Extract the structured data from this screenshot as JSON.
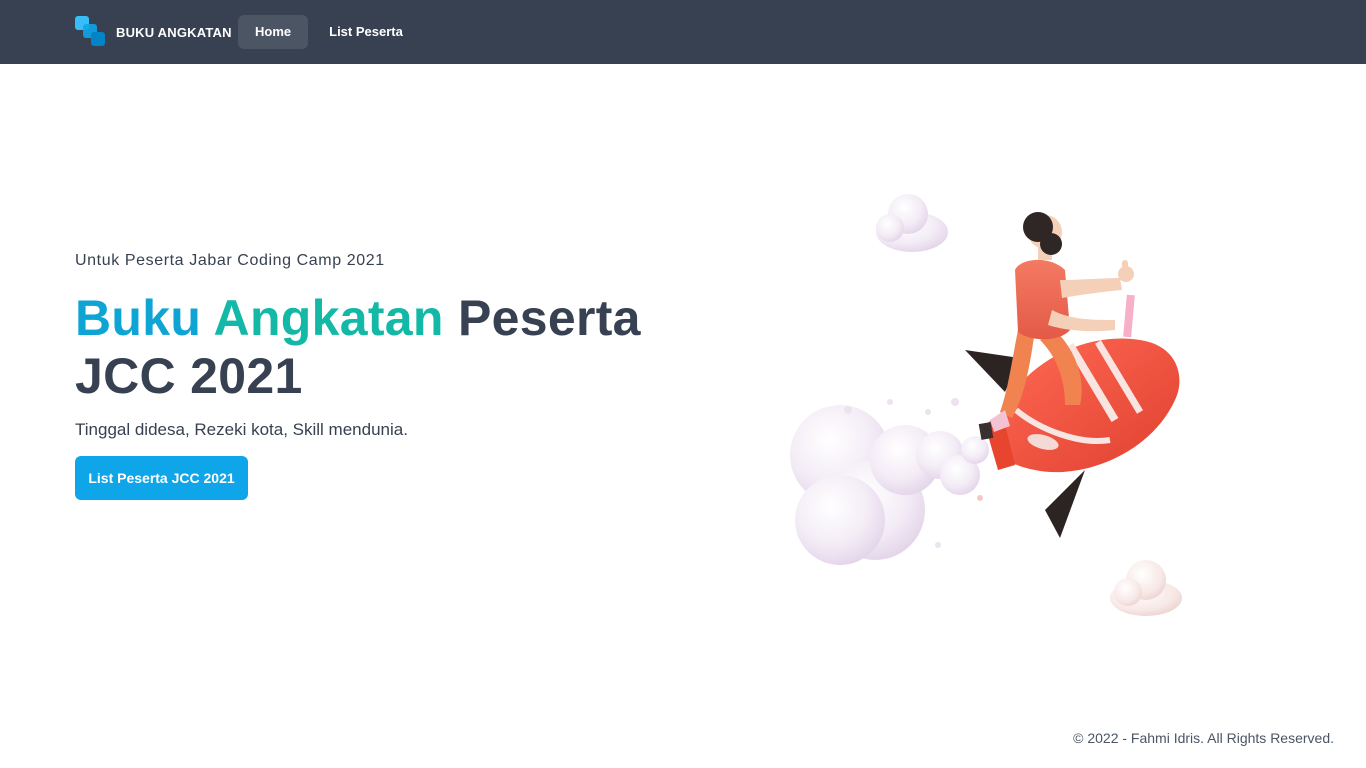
{
  "navbar": {
    "brand": "BUKU ANGKATAN",
    "links": [
      {
        "label": "Home",
        "active": true
      },
      {
        "label": "List Peserta",
        "active": false
      }
    ]
  },
  "hero": {
    "subtitle": "Untuk Peserta Jabar Coding Camp 2021",
    "headline_part1": "Buku",
    "headline_part2": "Angkatan",
    "headline_part3": "Peserta",
    "headline_part4": "JCC 2021",
    "tagline": "Tinggal didesa, Rezeki kota, Skill mendunia.",
    "cta_label": "List Peserta JCC 2021"
  },
  "footer": {
    "copyright": "© 2022 - Fahmi Idris. All Rights Reserved."
  },
  "colors": {
    "navbar_bg": "#374151",
    "accent_blue": "#0ea5e9",
    "headline_blue": "#0ea5d5",
    "headline_teal": "#14b8a6",
    "rocket_red": "#ef4444"
  },
  "icons": [
    "logo-icon",
    "rocket-illustration"
  ]
}
